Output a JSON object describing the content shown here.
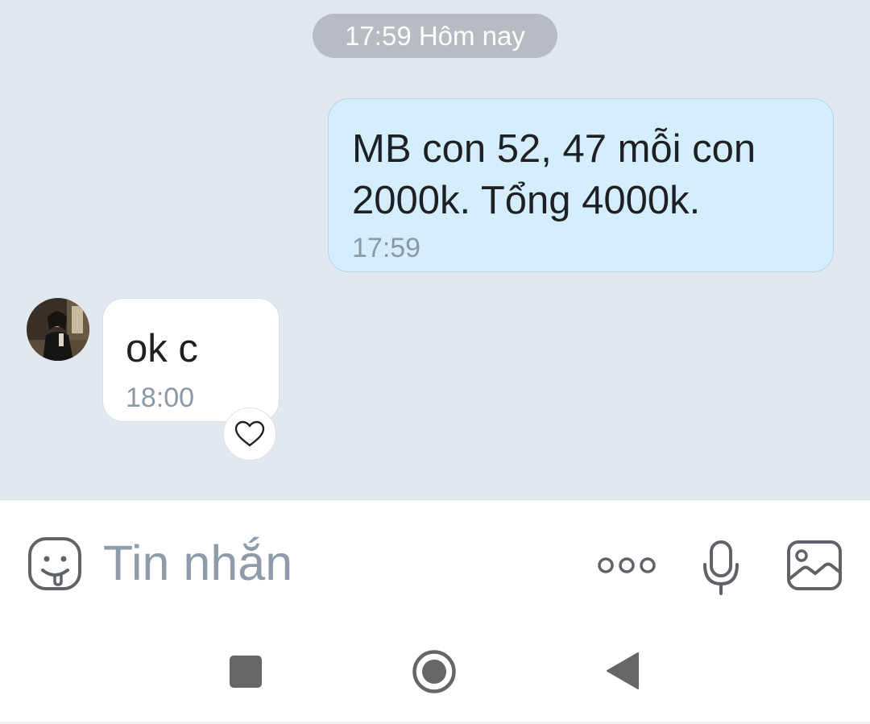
{
  "date_separator": "17:59 Hôm nay",
  "messages": [
    {
      "direction": "outgoing",
      "text": "MB con 52, 47 mỗi con\n2000k. Tổng 4000k.",
      "time": "17:59"
    },
    {
      "direction": "incoming",
      "text": "ok c",
      "time": "18:00"
    }
  ],
  "compose": {
    "placeholder": "Tin nhắn"
  },
  "icons": {
    "sticker": "sticker-face-icon",
    "more": "more-dots-icon",
    "mic": "microphone-icon",
    "image": "image-gallery-icon",
    "reaction": "heart-outline-icon",
    "nav_recents": "square-icon",
    "nav_home": "circle-icon",
    "nav_back": "triangle-back-icon"
  },
  "colors": {
    "chat_background": "#e1e8f0",
    "outgoing_bubble": "#d5eeff",
    "incoming_bubble": "#ffffff",
    "timestamp": "#8b98a6"
  }
}
